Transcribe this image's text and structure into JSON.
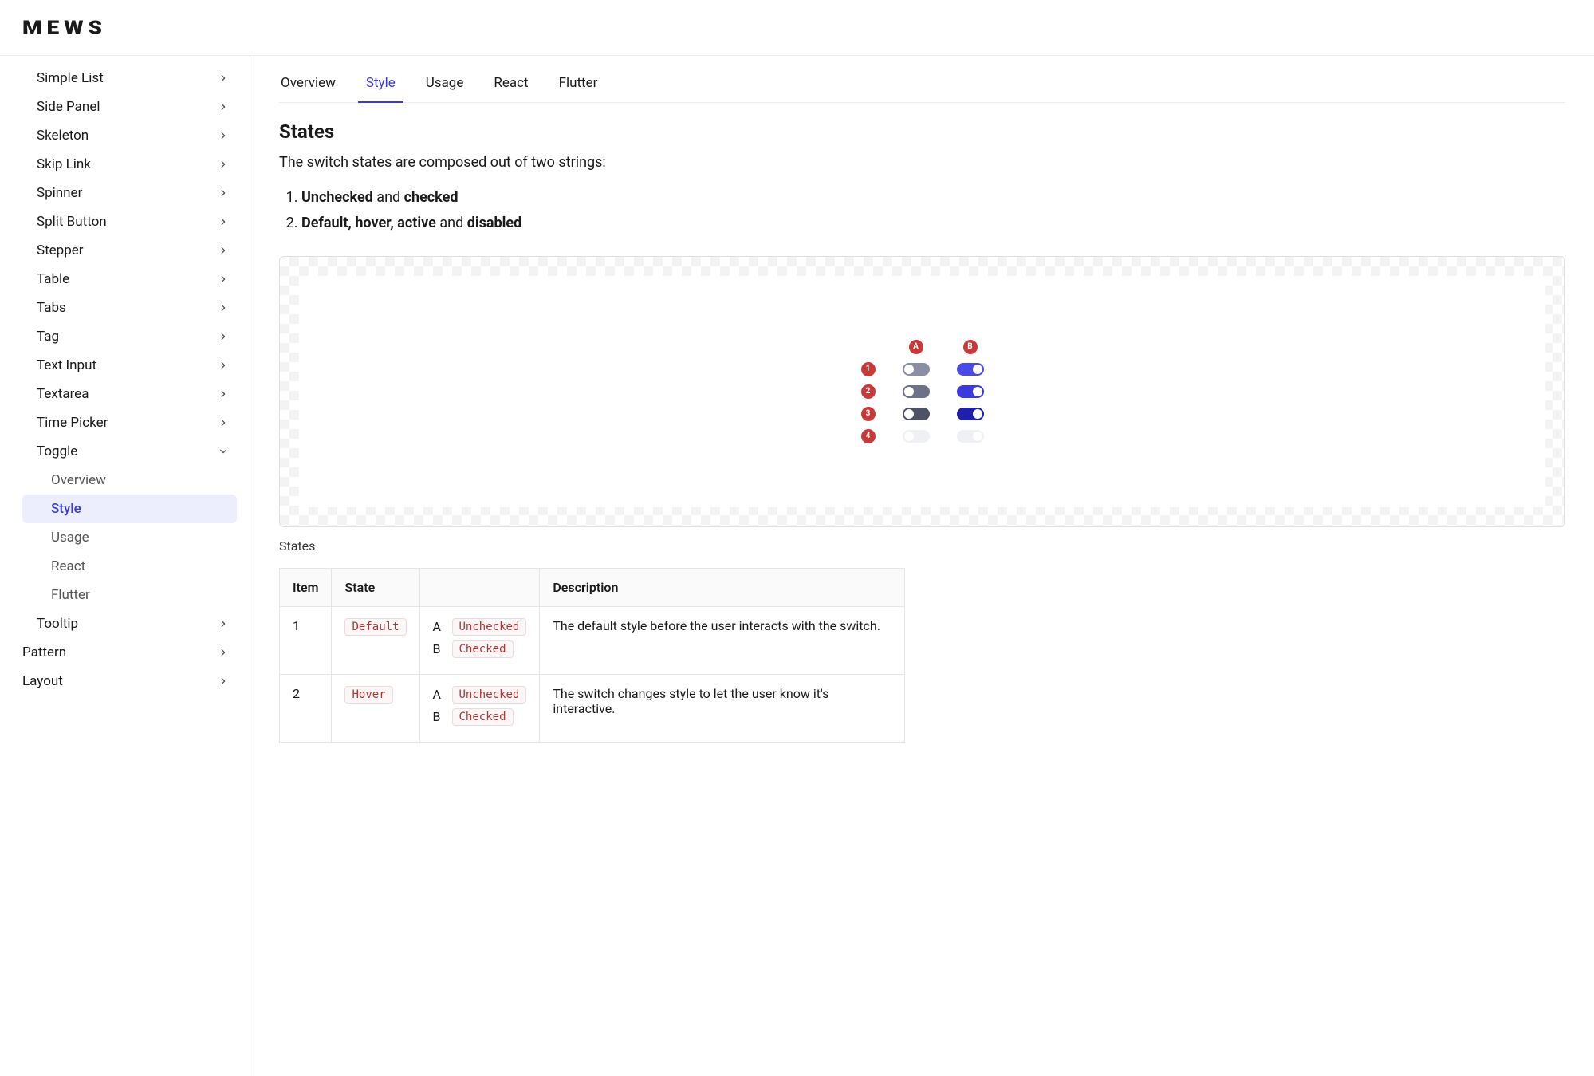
{
  "logo": "MEWS",
  "sidebar": {
    "items": [
      {
        "label": "Simple List",
        "level": 1,
        "expandable": true
      },
      {
        "label": "Side Panel",
        "level": 1,
        "expandable": true
      },
      {
        "label": "Skeleton",
        "level": 1,
        "expandable": true
      },
      {
        "label": "Skip Link",
        "level": 1,
        "expandable": true
      },
      {
        "label": "Spinner",
        "level": 1,
        "expandable": true
      },
      {
        "label": "Split Button",
        "level": 1,
        "expandable": true
      },
      {
        "label": "Stepper",
        "level": 1,
        "expandable": true
      },
      {
        "label": "Table",
        "level": 1,
        "expandable": true
      },
      {
        "label": "Tabs",
        "level": 1,
        "expandable": true
      },
      {
        "label": "Tag",
        "level": 1,
        "expandable": true
      },
      {
        "label": "Text Input",
        "level": 1,
        "expandable": true
      },
      {
        "label": "Textarea",
        "level": 1,
        "expandable": true
      },
      {
        "label": "Time Picker",
        "level": 1,
        "expandable": true
      },
      {
        "label": "Toggle",
        "level": 1,
        "expandable": true,
        "expanded": true
      },
      {
        "label": "Overview",
        "level": 2
      },
      {
        "label": "Style",
        "level": 2,
        "active": true
      },
      {
        "label": "Usage",
        "level": 2
      },
      {
        "label": "React",
        "level": 2
      },
      {
        "label": "Flutter",
        "level": 2
      },
      {
        "label": "Tooltip",
        "level": 1,
        "expandable": true
      },
      {
        "label": "Pattern",
        "level": 0,
        "expandable": true
      },
      {
        "label": "Layout",
        "level": 0,
        "expandable": true
      }
    ]
  },
  "tabs": [
    {
      "label": "Overview"
    },
    {
      "label": "Style",
      "active": true
    },
    {
      "label": "Usage"
    },
    {
      "label": "React"
    },
    {
      "label": "Flutter"
    }
  ],
  "section": {
    "title": "States",
    "subtitle": "The switch states are composed out of two strings:",
    "strings": [
      {
        "bold1": "Unchecked",
        "mid": " and ",
        "bold2": "checked"
      },
      {
        "bold1": "Default, hover, active",
        "mid": " and ",
        "bold2": "disabled"
      }
    ]
  },
  "figure": {
    "colA": "A",
    "colB": "B",
    "rows": [
      "1",
      "2",
      "3",
      "4"
    ],
    "caption": "States"
  },
  "table": {
    "headers": {
      "item": "Item",
      "state": "State",
      "variant": "",
      "description": "Description"
    },
    "rows": [
      {
        "item": "1",
        "state": "Default",
        "variants": [
          {
            "letter": "A",
            "value": "Unchecked"
          },
          {
            "letter": "B",
            "value": "Checked"
          }
        ],
        "description": "The default style before the user interacts with the switch."
      },
      {
        "item": "2",
        "state": "Hover",
        "variants": [
          {
            "letter": "A",
            "value": "Unchecked"
          },
          {
            "letter": "B",
            "value": "Checked"
          }
        ],
        "description": "The switch changes style to let the user know it's interactive."
      }
    ]
  }
}
